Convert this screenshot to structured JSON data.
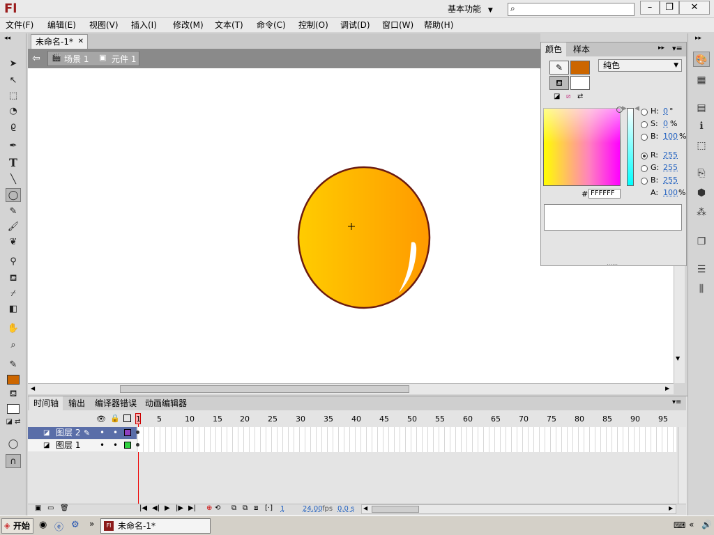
{
  "app": {
    "logo": "Fl"
  },
  "titlebar": {
    "workspace": "基本功能"
  },
  "menu": [
    {
      "label": "文件(F)"
    },
    {
      "label": "编辑(E)"
    },
    {
      "label": "视图(V)"
    },
    {
      "label": "插入(I)"
    },
    {
      "label": "修改(M)"
    },
    {
      "label": "文本(T)"
    },
    {
      "label": "命令(C)"
    },
    {
      "label": "控制(O)"
    },
    {
      "label": "调试(D)"
    },
    {
      "label": "窗口(W)"
    },
    {
      "label": "帮助(H)"
    }
  ],
  "document": {
    "tab": "未命名-1*",
    "breadcrumb": [
      {
        "label": "场景 1"
      },
      {
        "label": "元件 1"
      }
    ]
  },
  "colors": {
    "stroke": "#cc6600",
    "fill": "#ffffff",
    "ball_light": "#ffc800",
    "ball_dark": "#ff9a00",
    "ball_outline": "#6b1b10"
  },
  "color_panel": {
    "tabs": [
      {
        "label": "颜色"
      },
      {
        "label": "样本"
      }
    ],
    "type": "纯色",
    "hsb": [
      {
        "label": "H:",
        "value": "0",
        "unit": "°"
      },
      {
        "label": "S:",
        "value": "0",
        "unit": "%"
      },
      {
        "label": "B:",
        "value": "100",
        "unit": "%"
      }
    ],
    "rgb": [
      {
        "label": "R:",
        "value": "255"
      },
      {
        "label": "G:",
        "value": "255"
      },
      {
        "label": "B:",
        "value": "255"
      }
    ],
    "alpha": {
      "label": "A:",
      "value": "100",
      "unit": "%"
    },
    "hex_label": "#",
    "hex": "FFFFFF"
  },
  "timeline": {
    "tabs": [
      {
        "label": "时间轴"
      },
      {
        "label": "输出"
      },
      {
        "label": "编译器错误"
      },
      {
        "label": "动画编辑器"
      }
    ],
    "frame_numbers": [
      "1",
      "5",
      "10",
      "15",
      "20",
      "25",
      "30",
      "35",
      "40",
      "45",
      "50",
      "55",
      "60",
      "65",
      "70",
      "75",
      "80",
      "85",
      "90",
      "95"
    ],
    "layers": [
      {
        "name": "图层 2"
      },
      {
        "name": "图层 1"
      }
    ],
    "current_frame": "1",
    "fps": "24.00",
    "fps_unit": "fps",
    "time": "0.0 s"
  },
  "taskbar": {
    "start": "开始",
    "item": "未命名-1*"
  }
}
